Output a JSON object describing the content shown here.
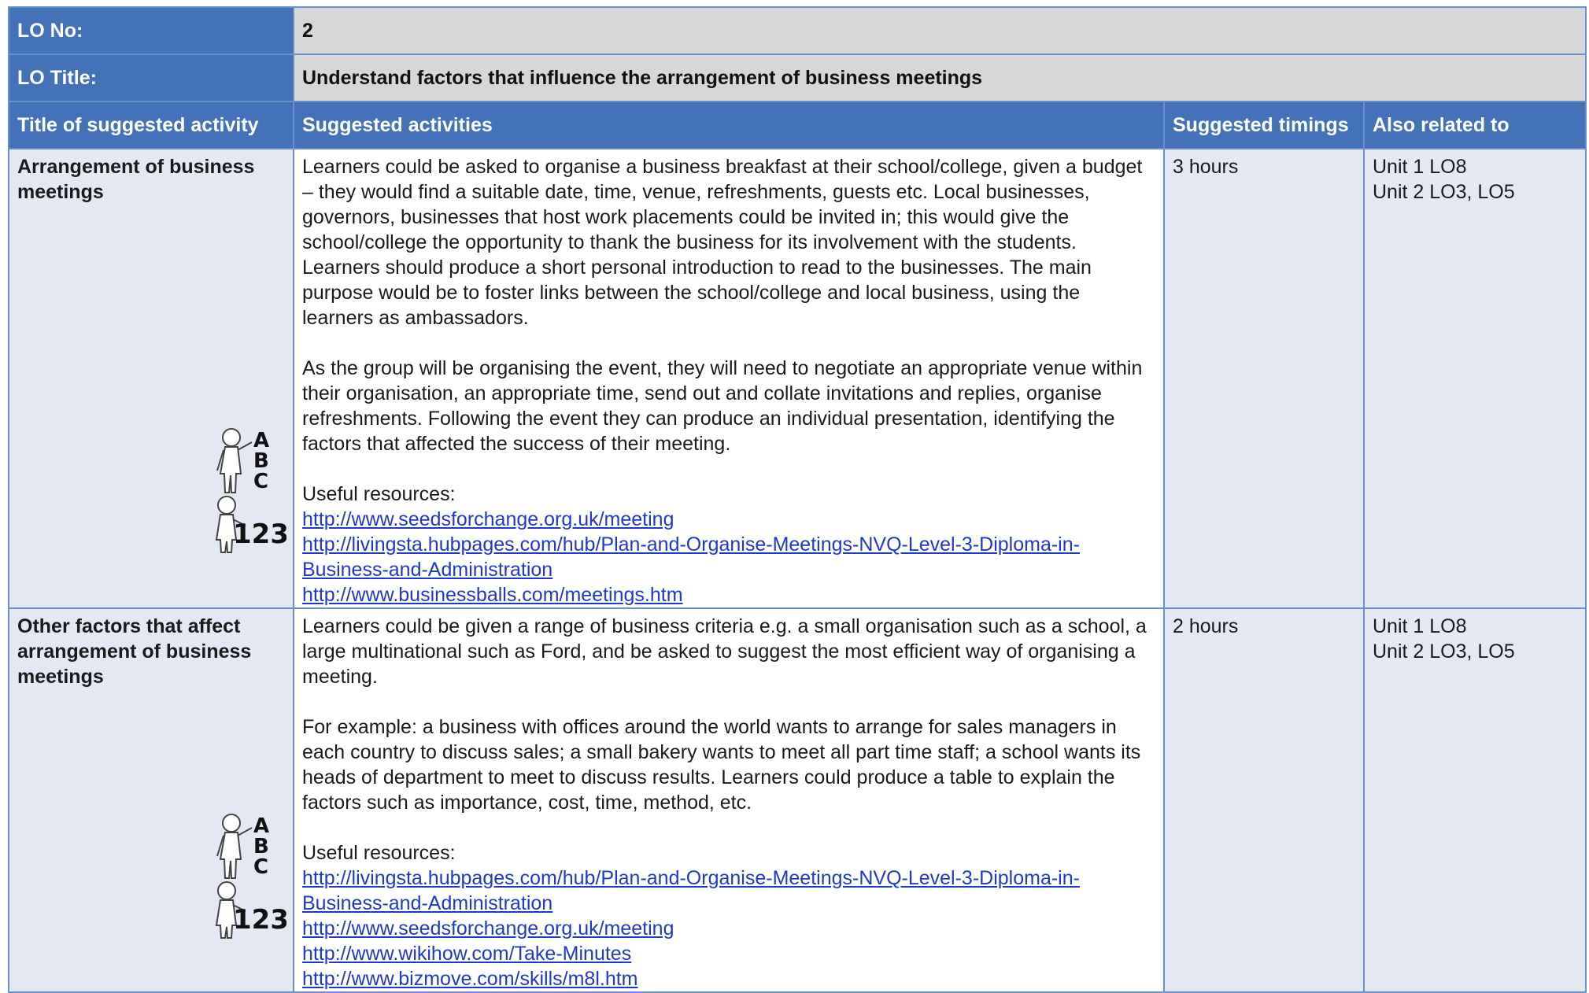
{
  "header": {
    "lo_no_label": "LO No:",
    "lo_no_value": "2",
    "lo_title_label": "LO Title:",
    "lo_title_value": "Understand factors that influence the arrangement of business meetings"
  },
  "columns": {
    "title": "Title of suggested activity",
    "activities": "Suggested activities",
    "timings": "Suggested timings",
    "related": "Also related to"
  },
  "rows": [
    {
      "title": "Arrangement of business meetings",
      "paragraphs": [
        "Learners could be asked to organise a business breakfast at their school/college, given a budget – they would find a suitable date, time, venue, refreshments, guests etc. Local businesses, governors, businesses that host work placements could be invited in; this would give the school/college the opportunity to thank the business for its involvement with the students. Learners should produce a short personal introduction to read to the businesses. The main purpose would be to foster links between the school/college and local business, using the learners as ambassadors.",
        "As the group will be organising the event, they will need to negotiate an appropriate venue within their organisation, an appropriate time, send out and collate invitations and replies, organise refreshments. Following the event they can produce an individual presentation, identifying the factors that affected the success of their meeting."
      ],
      "resources_label": "Useful resources:",
      "links": [
        "http://www.seedsforchange.org.uk/meeting",
        "http://livingsta.hubpages.com/hub/Plan-and-Organise-Meetings-NVQ-Level-3-Diploma-in-Business-and-Administration",
        "http://www.businessballs.com/meetings.htm"
      ],
      "timing": "3 hours",
      "related": [
        "Unit 1 LO8",
        "Unit 2 LO3, LO5"
      ]
    },
    {
      "title": "Other factors that affect arrangement of business meetings",
      "paragraphs": [
        "Learners could be given a range of business criteria e.g. a small organisation such as a school, a large multinational such as Ford, and be asked to suggest the most efficient way of organising a meeting.",
        "For example: a business with offices around the world wants to arrange for sales managers in each country to discuss sales; a small bakery wants to meet all part time staff; a school wants its heads of department to meet to discuss results. Learners could produce a table to explain the factors such as importance, cost, time, method, etc."
      ],
      "resources_label": "Useful resources:",
      "links": [
        "http://livingsta.hubpages.com/hub/Plan-and-Organise-Meetings-NVQ-Level-3-Diploma-in-Business-and-Administration",
        "http://www.seedsforchange.org.uk/meeting",
        "http://www.wikihow.com/Take-Minutes",
        "http://www.bizmove.com/skills/m8l.htm"
      ],
      "timing": "2 hours",
      "related": [
        "Unit 1 LO8",
        "Unit 2 LO3, LO5"
      ]
    }
  ],
  "icons": {
    "literacy_letters": [
      "A",
      "B",
      "C"
    ],
    "numeracy_digits": "123"
  }
}
